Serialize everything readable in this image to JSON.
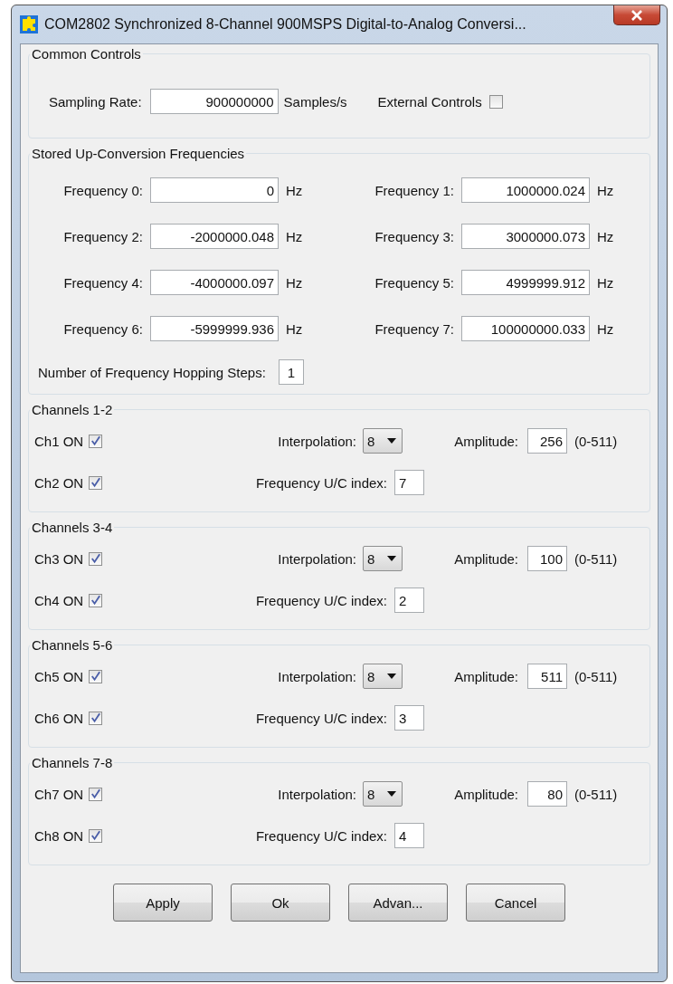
{
  "window": {
    "title": "COM2802 Synchronized 8-Channel 900MSPS Digital-to-Analog Conversi..."
  },
  "common_controls": {
    "title": "Common Controls",
    "sampling_rate": {
      "label": "Sampling Rate:",
      "value": "900000000",
      "unit": "Samples/s"
    },
    "external_controls": {
      "label": "External Controls",
      "checked": false
    }
  },
  "stored_frequencies": {
    "title": "Stored Up-Conversion Frequencies",
    "frequencies": [
      {
        "label": "Frequency 0:",
        "value": "0",
        "unit": "Hz"
      },
      {
        "label": "Frequency 1:",
        "value": "1000000.024",
        "unit": "Hz"
      },
      {
        "label": "Frequency 2:",
        "value": "-2000000.048",
        "unit": "Hz"
      },
      {
        "label": "Frequency 3:",
        "value": "3000000.073",
        "unit": "Hz"
      },
      {
        "label": "Frequency 4:",
        "value": "-4000000.097",
        "unit": "Hz"
      },
      {
        "label": "Frequency 5:",
        "value": "4999999.912",
        "unit": "Hz"
      },
      {
        "label": "Frequency 6:",
        "value": "-5999999.936",
        "unit": "Hz"
      },
      {
        "label": "Frequency 7:",
        "value": "100000000.033",
        "unit": "Hz"
      }
    ],
    "hopping_steps": {
      "label": "Number of Frequency Hopping Steps:",
      "value": "1"
    }
  },
  "channel_groups": [
    {
      "title": "Channels 1-2",
      "channels": [
        {
          "label": "Ch1 ON",
          "on": true
        },
        {
          "label": "Ch2 ON",
          "on": true
        }
      ],
      "interpolation": {
        "label": "Interpolation:",
        "value": "8"
      },
      "amplitude": {
        "label": "Amplitude:",
        "value": "256",
        "range": "(0-511)"
      },
      "uc_index": {
        "label": "Frequency U/C index:",
        "value": "7"
      }
    },
    {
      "title": "Channels 3-4",
      "channels": [
        {
          "label": "Ch3 ON",
          "on": true
        },
        {
          "label": "Ch4 ON",
          "on": true
        }
      ],
      "interpolation": {
        "label": "Interpolation:",
        "value": "8"
      },
      "amplitude": {
        "label": "Amplitude:",
        "value": "100",
        "range": "(0-511)"
      },
      "uc_index": {
        "label": "Frequency U/C index:",
        "value": "2"
      }
    },
    {
      "title": "Channels 5-6",
      "channels": [
        {
          "label": "Ch5 ON",
          "on": true
        },
        {
          "label": "Ch6 ON",
          "on": true
        }
      ],
      "interpolation": {
        "label": "Interpolation:",
        "value": "8"
      },
      "amplitude": {
        "label": "Amplitude:",
        "value": "511",
        "range": "(0-511)"
      },
      "uc_index": {
        "label": "Frequency U/C index:",
        "value": "3"
      }
    },
    {
      "title": "Channels 7-8",
      "channels": [
        {
          "label": "Ch7 ON",
          "on": true
        },
        {
          "label": "Ch8 ON",
          "on": true
        }
      ],
      "interpolation": {
        "label": "Interpolation:",
        "value": "8"
      },
      "amplitude": {
        "label": "Amplitude:",
        "value": "80",
        "range": "(0-511)"
      },
      "uc_index": {
        "label": "Frequency U/C index:",
        "value": "4"
      }
    }
  ],
  "buttons": [
    "Apply",
    "Ok",
    "Advan...",
    "Cancel"
  ]
}
